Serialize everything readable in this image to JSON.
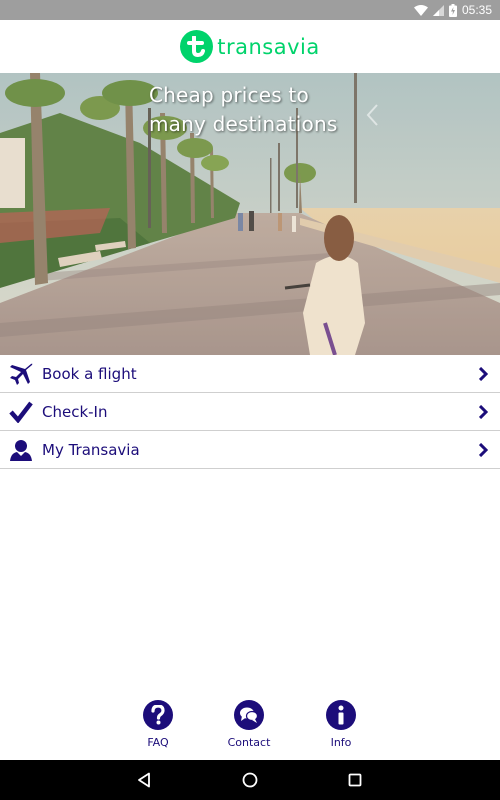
{
  "status_bar": {
    "time": "05:35",
    "icons": [
      "wifi-icon",
      "signal-icon",
      "battery-charging-icon"
    ]
  },
  "app_bar": {
    "brand_name": "transavia",
    "brand_color": "#00d36b"
  },
  "hero": {
    "title_line1": "Cheap prices to",
    "title_line2": "many destinations"
  },
  "menu": {
    "items": [
      {
        "label": "Book a flight",
        "icon": "airplane-icon"
      },
      {
        "label": "Check-In",
        "icon": "checkmark-icon"
      },
      {
        "label": "My Transavia",
        "icon": "user-icon"
      }
    ],
    "accent_color": "#1c0d7a"
  },
  "bottom_links": [
    {
      "label": "FAQ",
      "icon": "question-icon"
    },
    {
      "label": "Contact",
      "icon": "chat-bubbles-icon"
    },
    {
      "label": "Info",
      "icon": "info-icon"
    }
  ],
  "nav_bar": {
    "buttons": [
      "back-icon",
      "home-icon",
      "recents-icon"
    ]
  }
}
